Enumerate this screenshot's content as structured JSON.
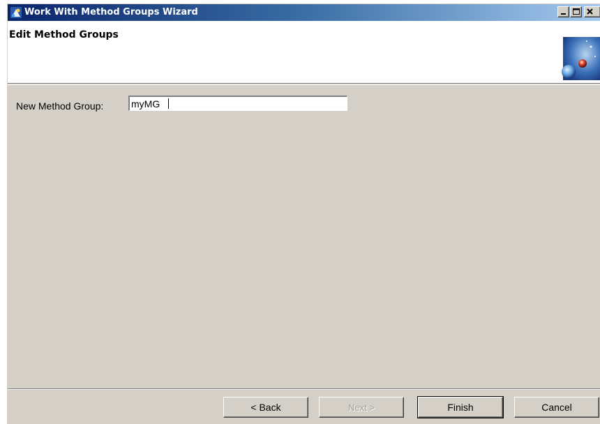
{
  "window": {
    "title": "Work With Method Groups Wizard",
    "icon": "wizard-app-icon"
  },
  "header": {
    "title": "Edit Method Groups",
    "graphic": "globe-graphic"
  },
  "form": {
    "new_method_group_label": "New Method Group:",
    "new_method_group_value": "myMG"
  },
  "buttons": {
    "back_label": "< Back",
    "next_label": "Next >",
    "finish_label": "Finish",
    "cancel_label": "Cancel"
  },
  "colors": {
    "titlebar_start": "#0a246a",
    "titlebar_end": "#a6caf0",
    "dialog_background": "#d4d0c8",
    "disabled_text": "#a0a0a0"
  }
}
